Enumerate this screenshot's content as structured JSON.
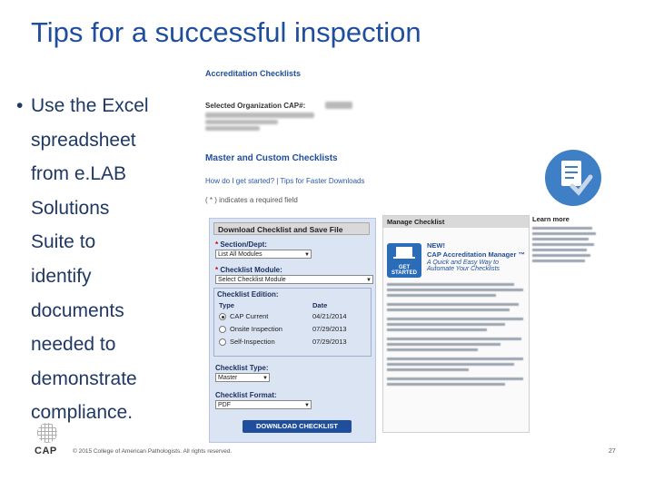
{
  "slide": {
    "title": "Tips for a successful inspection",
    "bullet_marker": "•",
    "bullet_lines": [
      "Use the Excel",
      "spreadsheet",
      "from e.LAB",
      "Solutions",
      "Suite to",
      "identify",
      "documents",
      "needed to",
      "demonstrate",
      "compliance."
    ],
    "footer": "© 2015 College of American Pathologists. All rights reserved.",
    "page_number": "27",
    "logo_text": "CAP"
  },
  "screenshot": {
    "accreditation_title": "Accreditation Checklists",
    "selected_org_label": "Selected Organization CAP#:",
    "section_title": "Master and Custom Checklists",
    "help_links": "How do I get started? | Tips for Faster Downloads",
    "required_note": "( * ) indicates a required field",
    "download_header": "Download Checklist and Save File",
    "section_label": "Section/Dept:",
    "section_value": "List All Modules",
    "module_label": "Checklist Module:",
    "module_value": "Select Checklist Module",
    "edition_label": "Checklist Edition:",
    "edition_type_header": "Type",
    "edition_date_header": "Date",
    "editions": [
      {
        "type": "CAP Current",
        "date": "04/21/2014",
        "selected": true
      },
      {
        "type": "Onsite Inspection",
        "date": "07/29/2013",
        "selected": false
      },
      {
        "type": "Self-Inspection",
        "date": "07/29/2013",
        "selected": false
      }
    ],
    "type_label": "Checklist Type:",
    "type_value": "Master",
    "format_label": "Checklist Format:",
    "format_value": "PDF",
    "download_button": "DOWNLOAD CHECKLIST",
    "manage_header": "Manage Checklist",
    "get_started": "GET STARTED",
    "new_label": "NEW!",
    "cam_title": "CAP Accreditation Manager ™",
    "cam_subtitle": "A Quick and Easy Way to Automate Your Checklists",
    "learn_more": "Learn more",
    "accent_color": "#1f4e9c"
  }
}
